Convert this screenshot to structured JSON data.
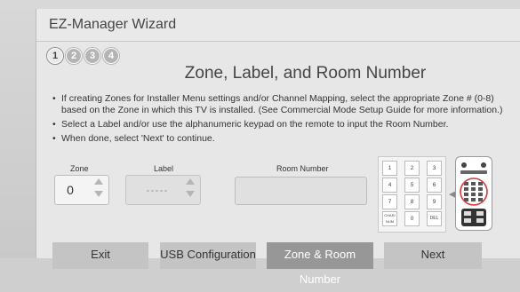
{
  "window": {
    "title": "EZ-Manager Wizard"
  },
  "steps": [
    "1",
    "2",
    "3",
    "4"
  ],
  "heading": "Zone, Label, and Room Number",
  "instructions": [
    "If creating Zones for Installer Menu settings and/or Channel Mapping, select the appropriate Zone # (0-8) based on the Zone in which this TV is installed. (See Commercial Mode Setup Guide for more information.)",
    "Select a Label and/or use the alphanumeric keypad on the remote to input the Room Number.",
    "When done, select 'Next' to continue."
  ],
  "fields": {
    "zone": {
      "label": "Zone",
      "value": "0"
    },
    "label": {
      "label": "Label",
      "value": "-----"
    },
    "room": {
      "label": "Room Number",
      "value": ""
    }
  },
  "keypad": [
    "1",
    "2",
    "3",
    "4",
    "5",
    "6",
    "7",
    "8",
    "9",
    "CHAR/ NUM",
    "0",
    "DEL"
  ],
  "buttons": {
    "exit": "Exit",
    "usb": "USB Configuration",
    "zone_room": "Zone & Room Number",
    "next": "Next"
  },
  "colors": {
    "selected_button": "#979797",
    "highlight_circle": "#d33a3a"
  }
}
